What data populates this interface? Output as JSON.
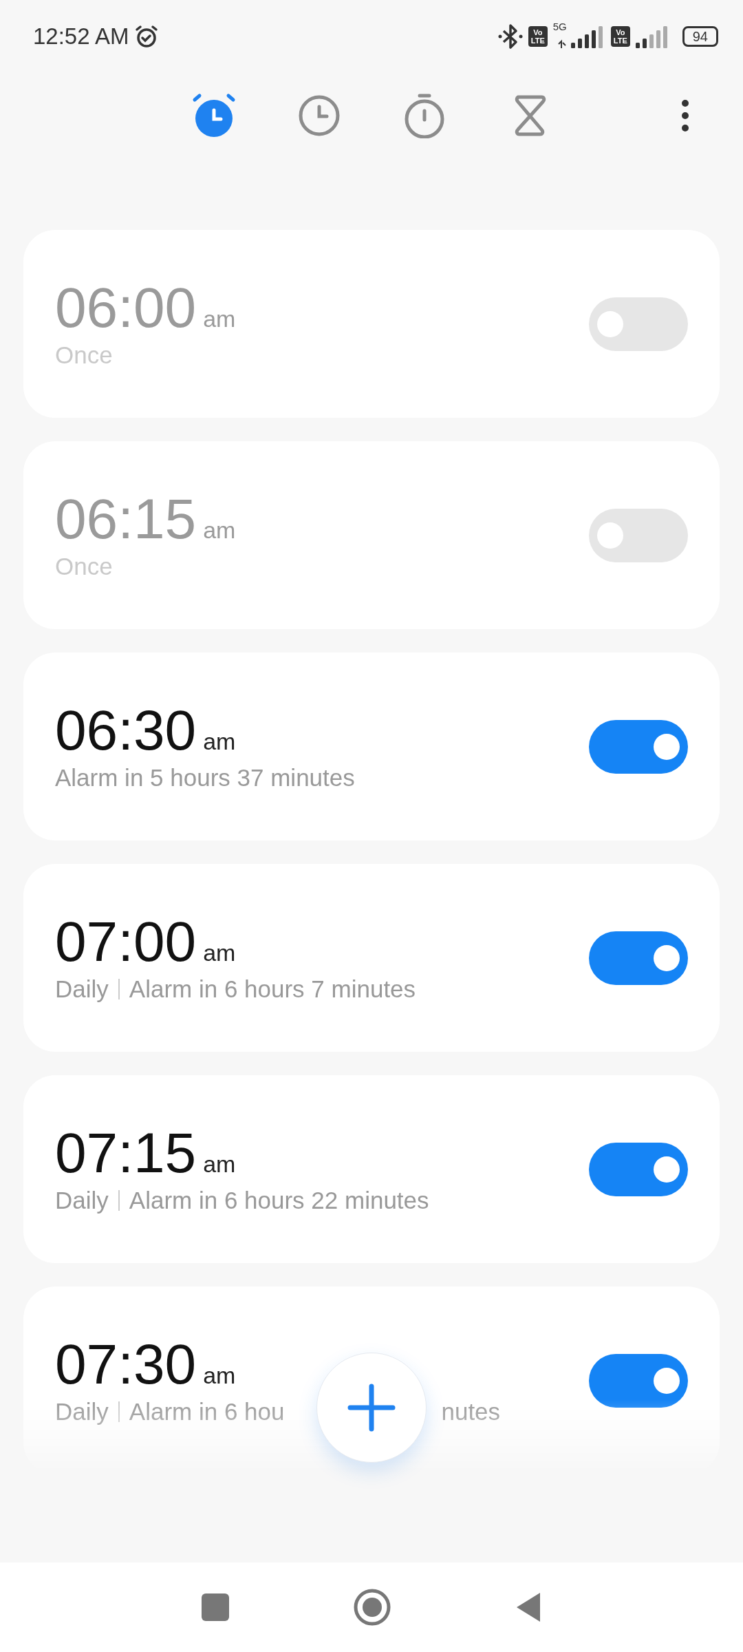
{
  "status_bar": {
    "time": "12:52 AM",
    "alarm_set": true,
    "sim1_badge": [
      "Vo",
      "LTE"
    ],
    "network": "5G",
    "sim2_badge": [
      "Vo",
      "LTE"
    ],
    "battery": "94"
  },
  "tabs": [
    {
      "kind": "alarm",
      "selected": true
    },
    {
      "kind": "clock",
      "selected": false
    },
    {
      "kind": "stopwatch",
      "selected": false
    },
    {
      "kind": "timer",
      "selected": false
    }
  ],
  "alarms": [
    {
      "time": "06:00",
      "period": "am",
      "on": false,
      "repeat": "Once"
    },
    {
      "time": "06:15",
      "period": "am",
      "on": false,
      "repeat": "Once"
    },
    {
      "time": "06:30",
      "period": "am",
      "on": true,
      "detail": [
        "Alarm in 5 hours 37 minutes"
      ]
    },
    {
      "time": "07:00",
      "period": "am",
      "on": true,
      "repeat": "Daily",
      "detail": [
        "Alarm in 6 hours 7 minutes"
      ]
    },
    {
      "time": "07:15",
      "period": "am",
      "on": true,
      "repeat": "Daily",
      "detail": [
        "Alarm in 6 hours 22 minutes"
      ]
    },
    {
      "time": "07:30",
      "period": "am",
      "on": true,
      "repeat": "Daily",
      "detail": [
        "Alarm in 6 hou",
        "nutes"
      ]
    }
  ]
}
